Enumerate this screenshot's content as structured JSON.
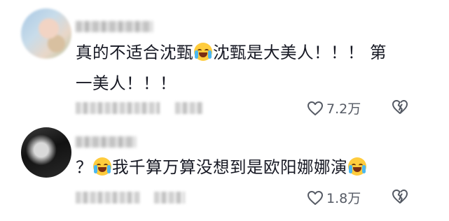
{
  "comments": [
    {
      "text_line1": "真的不适合沈甄",
      "text_line1b": "沈甄是大美人！！！ 第",
      "text_line2": "一美人！！！",
      "emoji_icon": "crying-face-icon",
      "like_count": "7.2万"
    },
    {
      "text_prefix": "？",
      "text_main": "我千算万算没想到是欧阳娜娜演",
      "emoji_icon": "laughing-tears-icon",
      "like_count": "1.8万"
    }
  ],
  "colors": {
    "text": "#161823",
    "meta": "#555a64",
    "emoji": "#ffcc3d"
  }
}
